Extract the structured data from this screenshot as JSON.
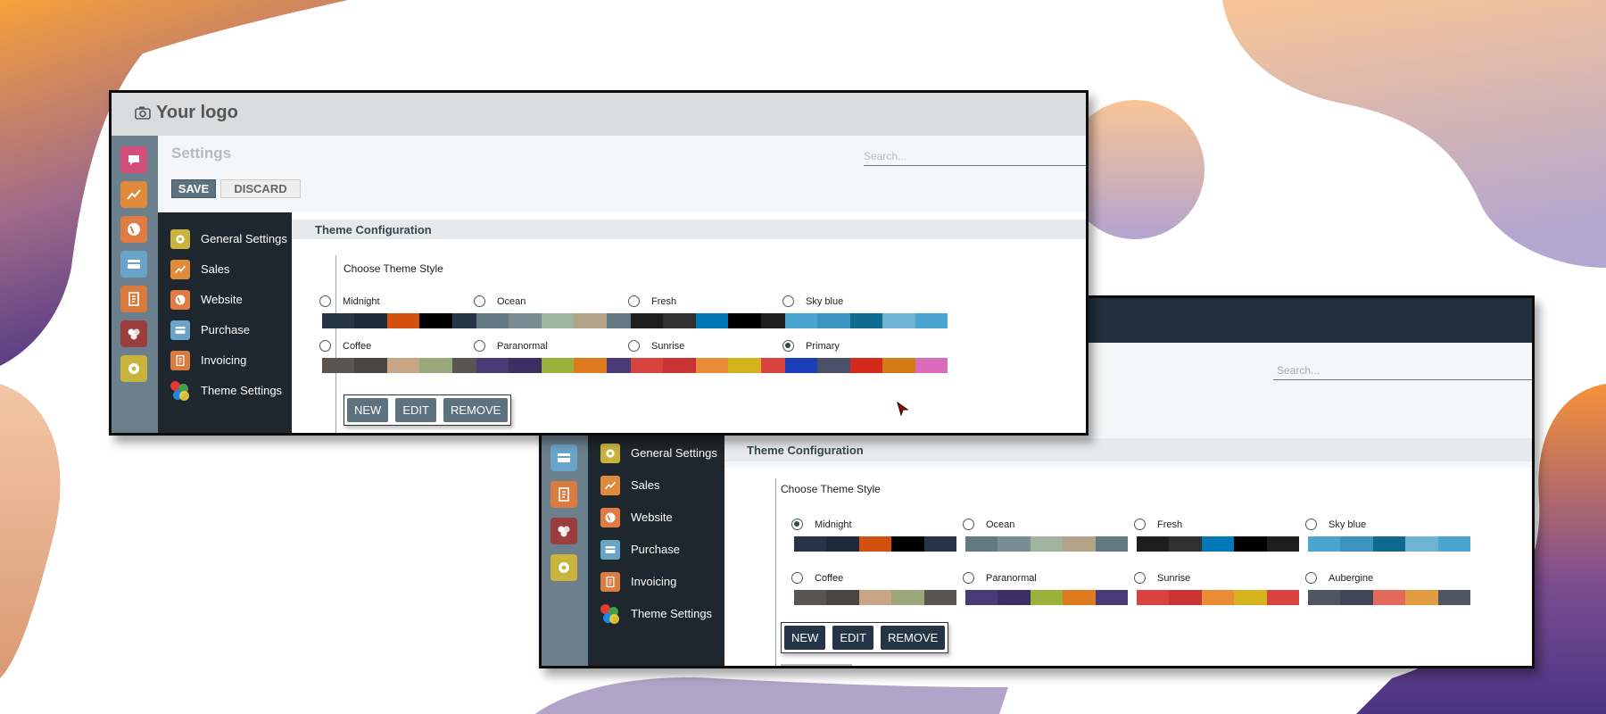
{
  "colors": {
    "bg_orange": "#f7a13a",
    "bg_purple": "#4d3584",
    "rail": "#6b7f8c",
    "sidebar": "#1e272d",
    "top_button_fill": "#5d727f",
    "bottom_button_fill": "#253547",
    "bottom_navbar": "#222f3e"
  },
  "front": {
    "logo_text": "Your logo",
    "camera_icon": "camera-icon",
    "page_title": "Settings",
    "save_label": "SAVE",
    "discard_label": "DISCARD",
    "search_placeholder": "Search...",
    "rail_icons": [
      {
        "name": "discuss-icon",
        "color": "#d14f7a"
      },
      {
        "name": "sales-chart-icon",
        "color": "#e08a3c"
      },
      {
        "name": "website-globe-icon",
        "color": "#df7b43"
      },
      {
        "name": "purchase-card-icon",
        "color": "#6aa3c8"
      },
      {
        "name": "invoice-icon",
        "color": "#d97a3f"
      },
      {
        "name": "apps-icon",
        "color": "#9b3d3d"
      },
      {
        "name": "settings-gear-icon",
        "color": "#c8b43c"
      }
    ],
    "sidebar": [
      {
        "label": "General Settings",
        "icon": "gear-icon",
        "color": "#c8b43c"
      },
      {
        "label": "Sales",
        "icon": "chart-icon",
        "color": "#e08a3c"
      },
      {
        "label": "Website",
        "icon": "globe-icon",
        "color": "#df7b43"
      },
      {
        "label": "Purchase",
        "icon": "card-icon",
        "color": "#6aa3c8"
      },
      {
        "label": "Invoicing",
        "icon": "invoice-icon",
        "color": "#d97a3f"
      },
      {
        "label": "Theme Settings",
        "icon": "theme-dots-icon"
      }
    ],
    "section_title": "Theme Configuration",
    "choose_label": "Choose Theme Style",
    "themes": [
      {
        "name": "Midnight",
        "checked": false,
        "colors": [
          "#253547",
          "#1c2a3a",
          "#d4500f",
          "#000000",
          "#253547"
        ]
      },
      {
        "name": "Ocean",
        "checked": false,
        "colors": [
          "#627882",
          "#7a8d93",
          "#9fb49d",
          "#b4a289",
          "#627882"
        ]
      },
      {
        "name": "Fresh",
        "checked": false,
        "colors": [
          "#1e1e1e",
          "#303030",
          "#0078b8",
          "#000000",
          "#1e1e1e"
        ]
      },
      {
        "name": "Sky blue",
        "checked": false,
        "colors": [
          "#4aa5d0",
          "#3b94bf",
          "#0f6a8f",
          "#6fb3d3",
          "#4aa5d0"
        ]
      },
      {
        "name": "Coffee",
        "checked": false,
        "colors": [
          "#5a5550",
          "#4a4541",
          "#c8a584",
          "#9aa77a",
          "#5a5550"
        ]
      },
      {
        "name": "Paranormal",
        "checked": false,
        "colors": [
          "#4b3a78",
          "#3c2f63",
          "#9bb23a",
          "#e07a1e",
          "#4b3a78"
        ]
      },
      {
        "name": "Sunrise",
        "checked": false,
        "colors": [
          "#d9433f",
          "#c93333",
          "#e98c35",
          "#d4b21b",
          "#d9433f"
        ]
      },
      {
        "name": "Primary",
        "checked": true,
        "colors": [
          "#1b3fba",
          "#4a5068",
          "#d32a1c",
          "#d27a14",
          "#d96bbd"
        ]
      }
    ],
    "buttons": [
      "NEW",
      "EDIT",
      "REMOVE"
    ]
  },
  "back": {
    "search_placeholder": "Search...",
    "rail_icons": [
      {
        "name": "website-globe-icon",
        "color": "#df7b43"
      },
      {
        "name": "purchase-card-icon",
        "color": "#6aa3c8"
      },
      {
        "name": "invoice-icon",
        "color": "#d97a3f"
      },
      {
        "name": "apps-icon",
        "color": "#9b3d3d"
      },
      {
        "name": "settings-gear-icon",
        "color": "#c8b43c"
      }
    ],
    "sidebar": [
      {
        "label": "General Settings",
        "icon": "gear-icon",
        "color": "#c8b43c"
      },
      {
        "label": "Sales",
        "icon": "chart-icon",
        "color": "#e08a3c"
      },
      {
        "label": "Website",
        "icon": "globe-icon",
        "color": "#df7b43"
      },
      {
        "label": "Purchase",
        "icon": "card-icon",
        "color": "#6aa3c8"
      },
      {
        "label": "Invoicing",
        "icon": "invoice-icon",
        "color": "#d97a3f"
      },
      {
        "label": "Theme Settings",
        "icon": "theme-dots-icon"
      }
    ],
    "section_title": "Theme Configuration",
    "choose_label": "Choose Theme Style",
    "themes": [
      {
        "name": "Midnight",
        "checked": true,
        "colors": [
          "#253547",
          "#1c2a3a",
          "#d4500f",
          "#000000",
          "#253547"
        ]
      },
      {
        "name": "Ocean",
        "checked": false,
        "colors": [
          "#627882",
          "#7a8d93",
          "#9fb49d",
          "#b4a289",
          "#627882"
        ]
      },
      {
        "name": "Fresh",
        "checked": false,
        "colors": [
          "#1e1e1e",
          "#303030",
          "#0078b8",
          "#000000",
          "#1e1e1e"
        ]
      },
      {
        "name": "Sky blue",
        "checked": false,
        "colors": [
          "#4aa5d0",
          "#3b94bf",
          "#0f6a8f",
          "#6fb3d3",
          "#4aa5d0"
        ]
      },
      {
        "name": "Coffee",
        "checked": false,
        "colors": [
          "#5a5550",
          "#4a4541",
          "#c8a584",
          "#9aa77a",
          "#5a5550"
        ]
      },
      {
        "name": "Paranormal",
        "checked": false,
        "colors": [
          "#4b3a78",
          "#3c2f63",
          "#9bb23a",
          "#e07a1e",
          "#4b3a78"
        ]
      },
      {
        "name": "Sunrise",
        "checked": false,
        "colors": [
          "#d9433f",
          "#c93333",
          "#e98c35",
          "#d4b21b",
          "#d9433f"
        ]
      },
      {
        "name": "Aubergine",
        "checked": false,
        "colors": [
          "#4f5663",
          "#3e4557",
          "#e36a5a",
          "#e09b43",
          "#4f5663"
        ]
      }
    ],
    "buttons": [
      "NEW",
      "EDIT",
      "REMOVE"
    ]
  }
}
